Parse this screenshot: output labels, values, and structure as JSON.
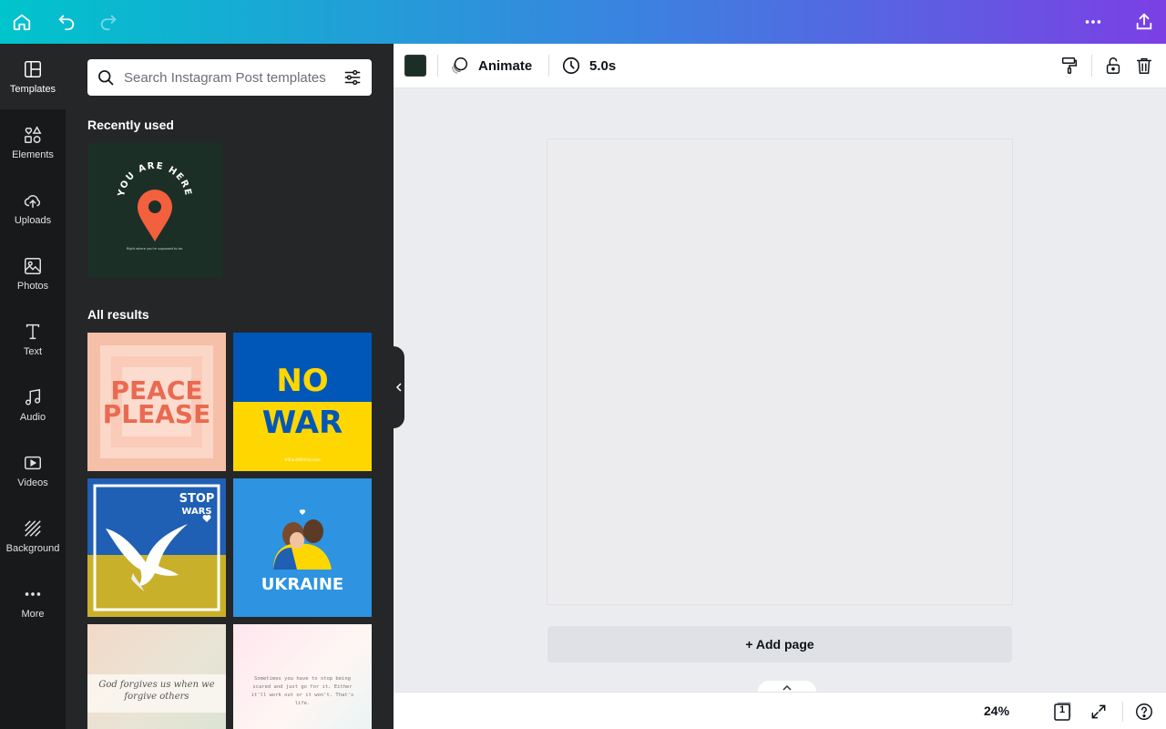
{
  "colors": {
    "accent_start": "#00c4cc",
    "accent_end": "#7b3fe4",
    "rail_bg": "#18191b",
    "panel_bg": "#252627",
    "swatch": "#1c2f26"
  },
  "topbar": {
    "home_icon": "home-icon",
    "undo_icon": "undo-icon",
    "redo_icon": "redo-icon",
    "more_icon": "more-horizontal-icon",
    "share_icon": "share-icon"
  },
  "rail": {
    "items": [
      {
        "label": "Templates",
        "icon": "templates-icon"
      },
      {
        "label": "Elements",
        "icon": "elements-icon"
      },
      {
        "label": "Uploads",
        "icon": "upload-cloud-icon"
      },
      {
        "label": "Photos",
        "icon": "photo-icon"
      },
      {
        "label": "Text",
        "icon": "text-icon"
      },
      {
        "label": "Audio",
        "icon": "music-note-icon"
      },
      {
        "label": "Videos",
        "icon": "video-icon"
      },
      {
        "label": "Background",
        "icon": "background-icon"
      },
      {
        "label": "More",
        "icon": "more-horizontal-icon"
      }
    ]
  },
  "panel": {
    "search_placeholder": "Search Instagram Post templates",
    "recently_used_title": "Recently used",
    "all_results_title": "All results",
    "recent_template": {
      "line1": "YOU ARE HERE",
      "caption": "Right where you're supposed to be."
    },
    "results": [
      {
        "line1": "PEACE",
        "line2": "PLEASE"
      },
      {
        "line1": "NO",
        "line2": "WAR",
        "caption": "#StandWithUkraine"
      },
      {
        "line1": "STOP",
        "line2": "WARS"
      },
      {
        "line1": "UKRAINE"
      },
      {
        "quote": "God forgives us when we forgive others"
      },
      {
        "quote": "Sometimes you have to stop being scared and just go for it. Either it'll work out or it won't. That's life."
      }
    ]
  },
  "toolbar": {
    "animate_label": "Animate",
    "duration_label": "5.0s"
  },
  "canvas": {
    "add_page_label": "+ Add page"
  },
  "bottombar": {
    "zoom_label": "24%",
    "page_count": "1"
  }
}
